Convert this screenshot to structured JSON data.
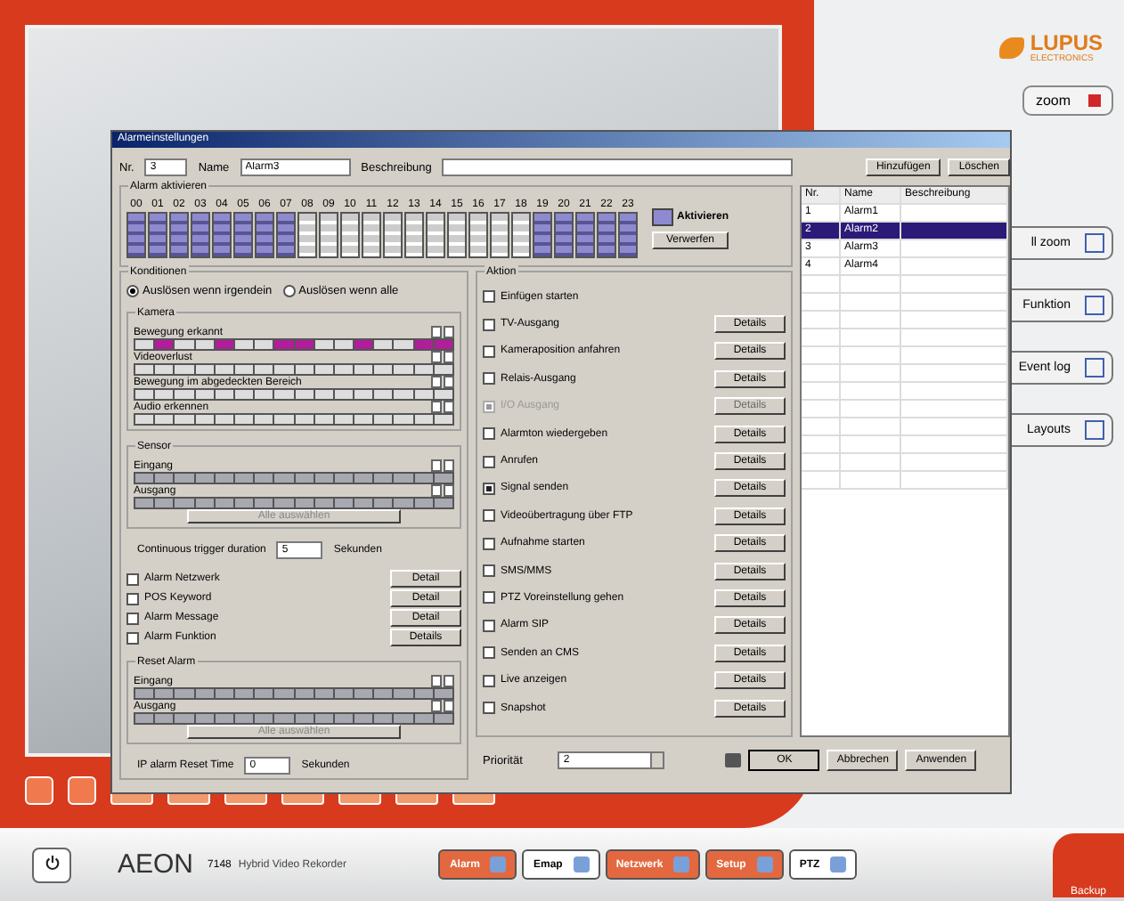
{
  "app": {
    "logo": {
      "brand": "LUPUS",
      "sub": "ELECTRONICS"
    },
    "zoom_button": "zoom",
    "side_buttons": [
      {
        "label": "ll zoom"
      },
      {
        "label": "Funktion"
      },
      {
        "label": "Event log"
      },
      {
        "label": "Layouts"
      }
    ],
    "bottom": {
      "brand": "AEON",
      "model": "7148",
      "product": "Hybrid Video Rekorder"
    },
    "tabs": [
      {
        "label": "Alarm",
        "selected": true
      },
      {
        "label": "Emap",
        "selected": false
      },
      {
        "label": "Netzwerk",
        "selected": true
      },
      {
        "label": "Setup",
        "selected": true
      },
      {
        "label": "PTZ",
        "selected": false
      }
    ],
    "corner": "Backup"
  },
  "dialog": {
    "title": "Alarmeinstellungen",
    "fields": [
      {
        "label": "Nr.",
        "value": "3"
      },
      {
        "label": "Name",
        "value": "Alarm3"
      },
      {
        "label": "Beschreibung"
      }
    ],
    "schedule": {
      "title": "Alarm aktivieren",
      "hours": [
        {
          "label": "00",
          "active": true
        },
        {
          "label": "01",
          "active": true
        },
        {
          "label": "02",
          "active": true
        },
        {
          "label": "03",
          "active": true
        },
        {
          "label": "04",
          "active": true
        },
        {
          "label": "05",
          "active": true
        },
        {
          "label": "06",
          "active": true
        },
        {
          "label": "07",
          "active": true
        },
        {
          "label": "08",
          "active": false
        },
        {
          "label": "09",
          "active": false
        },
        {
          "label": "10",
          "active": false
        },
        {
          "label": "11",
          "active": false
        },
        {
          "label": "12",
          "active": false
        },
        {
          "label": "13",
          "active": false
        },
        {
          "label": "14",
          "active": false
        },
        {
          "label": "15",
          "active": false
        },
        {
          "label": "16",
          "active": false
        },
        {
          "label": "17",
          "active": false
        },
        {
          "label": "18",
          "active": false
        },
        {
          "label": "19",
          "active": true
        },
        {
          "label": "20",
          "active": true
        },
        {
          "label": "21",
          "active": true
        },
        {
          "label": "22",
          "active": true
        },
        {
          "label": "23",
          "active": true
        }
      ],
      "legend": "Aktivieren",
      "reset_button": "Verwerfen"
    },
    "conditions": {
      "title": "Konditionen",
      "modes": [
        {
          "label": "Auslösen wenn irgendein",
          "selected": true
        },
        {
          "label": "Auslösen wenn alle",
          "selected": false
        }
      ],
      "camera": {
        "title": "Kamera",
        "rows": [
          {
            "label": "Bewegung erkannt",
            "channels": [
              {
                "selected": false
              },
              {
                "selected": true
              },
              {
                "selected": false
              },
              {
                "selected": false
              },
              {
                "selected": true
              },
              {
                "selected": false
              },
              {
                "selected": false
              },
              {
                "selected": true
              },
              {
                "selected": true
              },
              {
                "selected": false
              },
              {
                "selected": false
              },
              {
                "selected": true
              },
              {
                "selected": false
              },
              {
                "selected": false
              },
              {
                "selected": true
              },
              {
                "selected": true
              }
            ]
          },
          {
            "label": "Videoverlust",
            "channels": [
              {
                "selected": false
              },
              {
                "selected": false
              },
              {
                "selected": false
              },
              {
                "selected": false
              },
              {
                "selected": false
              },
              {
                "selected": false
              },
              {
                "selected": false
              },
              {
                "selected": false
              },
              {
                "selected": false
              },
              {
                "selected": false
              },
              {
                "selected": false
              },
              {
                "selected": false
              },
              {
                "selected": false
              },
              {
                "selected": false
              },
              {
                "selected": false
              },
              {
                "selected": false
              }
            ]
          },
          {
            "label": "Bewegung im abgedeckten Bereich",
            "channels": [
              {
                "selected": false
              },
              {
                "selected": false
              },
              {
                "selected": false
              },
              {
                "selected": false
              },
              {
                "selected": false
              },
              {
                "selected": false
              },
              {
                "selected": false
              },
              {
                "selected": false
              },
              {
                "selected": false
              },
              {
                "selected": false
              },
              {
                "selected": false
              },
              {
                "selected": false
              },
              {
                "selected": false
              },
              {
                "selected": false
              },
              {
                "selected": false
              },
              {
                "selected": false
              }
            ]
          },
          {
            "label": "Audio erkennen",
            "channels": [
              {
                "selected": false
              },
              {
                "selected": false
              },
              {
                "selected": false
              },
              {
                "selected": false
              },
              {
                "selected": false
              },
              {
                "selected": false
              },
              {
                "selected": false
              },
              {
                "selected": false
              },
              {
                "selected": false
              },
              {
                "selected": false
              },
              {
                "selected": false
              },
              {
                "selected": false
              },
              {
                "selected": false
              },
              {
                "selected": false
              },
              {
                "selected": false
              },
              {
                "selected": false
              }
            ]
          }
        ]
      },
      "sensor": {
        "title": "Sensor",
        "rows": [
          {
            "label": "Eingang"
          },
          {
            "label": "Ausgang"
          }
        ],
        "button": "Alle auswählen"
      },
      "duration": {
        "label": "Continuous trigger duration",
        "value": "5",
        "unit": "Sekunden"
      },
      "checks": [
        {
          "label": "Alarm Netzwerk",
          "checked": false,
          "button": "Detail"
        },
        {
          "label": "POS Keyword",
          "checked": false,
          "button": "Detail"
        },
        {
          "label": "Alarm Message",
          "checked": false,
          "button": "Detail"
        },
        {
          "label": "Alarm Funktion",
          "checked": false,
          "button": "Details"
        }
      ],
      "reset": {
        "title": "Reset Alarm",
        "rows": [
          {
            "label": "Eingang"
          },
          {
            "label": "Ausgang"
          }
        ],
        "button": "Alle auswählen"
      },
      "reset_time": {
        "label": "IP alarm Reset Time",
        "value": "0",
        "unit": "Sekunden"
      }
    },
    "actions": {
      "title": "Aktion",
      "items": [
        {
          "label": "Einfügen starten",
          "checked": false,
          "disabled": false
        },
        {
          "label": "TV-Ausgang",
          "checked": false,
          "disabled": false,
          "button": "Details"
        },
        {
          "label": "Kameraposition anfahren",
          "checked": false,
          "disabled": false,
          "button": "Details"
        },
        {
          "label": "Relais-Ausgang",
          "checked": false,
          "disabled": false,
          "button": "Details"
        },
        {
          "label": "I/O Ausgang",
          "checked": true,
          "disabled": true,
          "button": "Details"
        },
        {
          "label": "Alarmton wiedergeben",
          "checked": false,
          "disabled": false,
          "button": "Details"
        },
        {
          "label": "Anrufen",
          "checked": false,
          "disabled": false,
          "button": "Details"
        },
        {
          "label": "Signal senden",
          "checked": true,
          "disabled": false,
          "button": "Details"
        },
        {
          "label": "Videoübertragung über FTP",
          "checked": false,
          "disabled": false,
          "button": "Details"
        },
        {
          "label": "Aufnahme starten",
          "checked": false,
          "disabled": false,
          "button": "Details"
        },
        {
          "label": "SMS/MMS",
          "checked": false,
          "disabled": false,
          "button": "Details"
        },
        {
          "label": "PTZ Voreinstellung gehen",
          "checked": false,
          "disabled": false,
          "button": "Details"
        },
        {
          "label": "Alarm SIP",
          "checked": false,
          "disabled": false,
          "button": "Details"
        },
        {
          "label": "Senden an CMS",
          "checked": false,
          "disabled": false,
          "button": "Details"
        },
        {
          "label": "Live anzeigen",
          "checked": false,
          "disabled": false,
          "button": "Details"
        },
        {
          "label": "Snapshot",
          "checked": false,
          "disabled": false,
          "button": "Details"
        }
      ]
    },
    "priority": {
      "label": "Priorität",
      "value": "2"
    },
    "list_buttons": [
      "Hinzufügen",
      "Löschen"
    ],
    "table": {
      "columns": [
        "Nr.",
        "Name",
        "Beschreibung"
      ],
      "rows": [
        {
          "cells": [
            "1",
            "Alarm1"
          ],
          "selected": false
        },
        {
          "cells": [
            "2",
            "Alarm2"
          ],
          "selected": true
        },
        {
          "cells": [
            "3",
            "Alarm3"
          ],
          "selected": false
        },
        {
          "cells": [
            "4",
            "Alarm4"
          ],
          "selected": false
        }
      ]
    },
    "buttons": [
      "OK",
      "Abbrechen",
      "Anwenden"
    ]
  }
}
